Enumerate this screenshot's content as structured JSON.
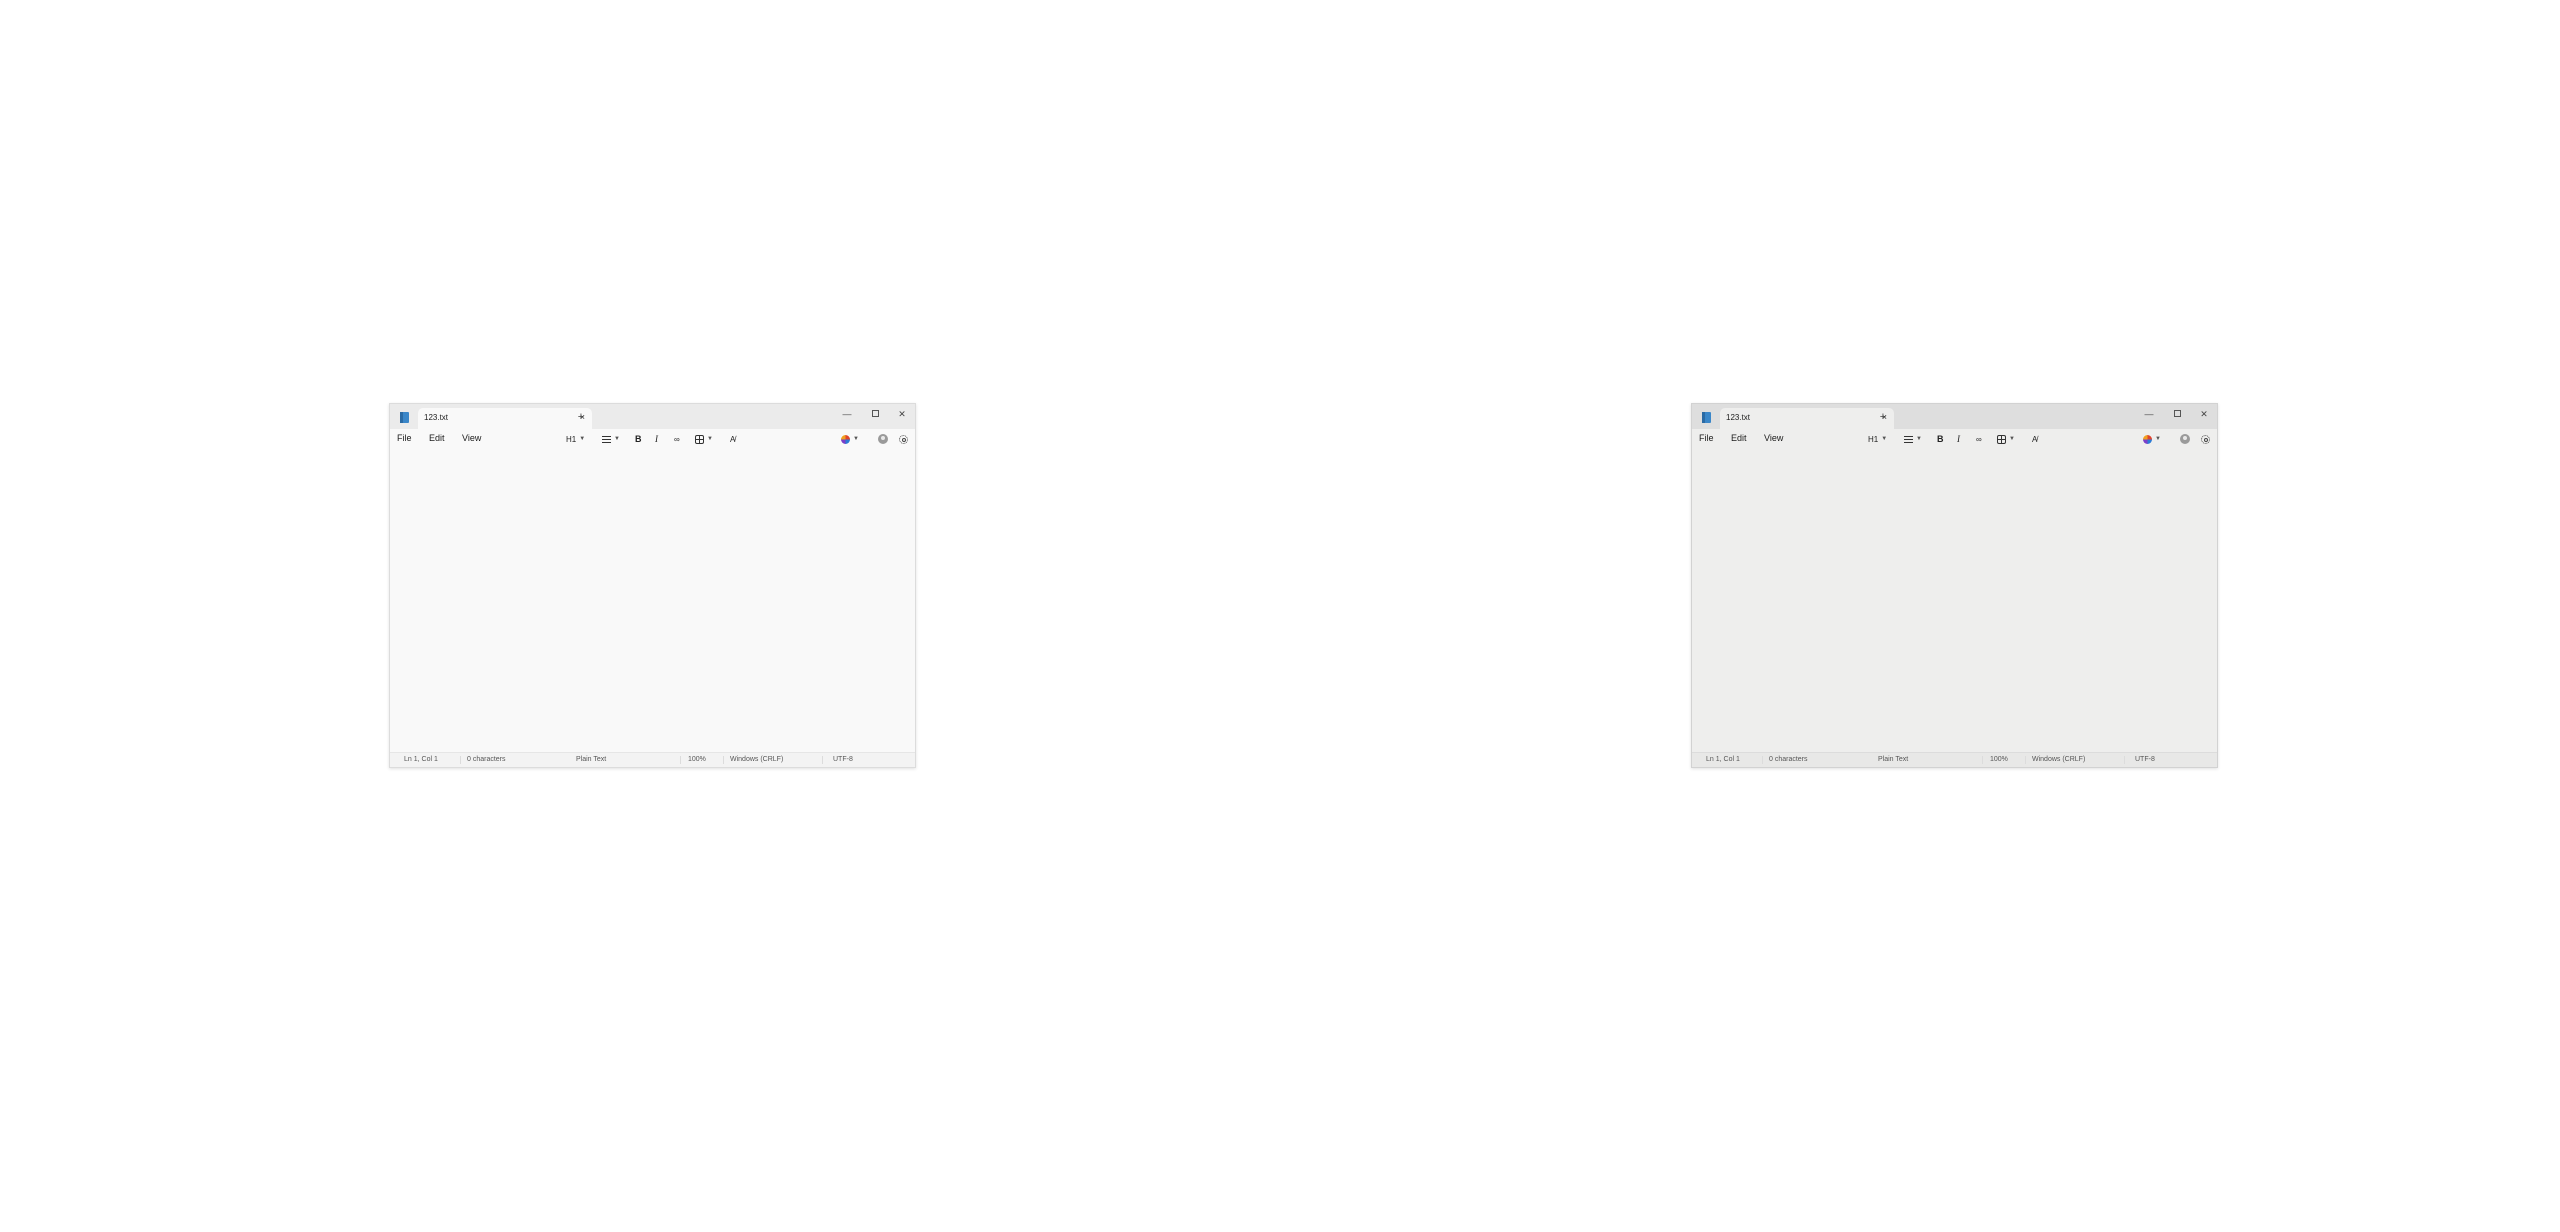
{
  "windows": [
    {
      "tab": {
        "title": "123.txt",
        "close_label": "×"
      },
      "new_tab_label": "+",
      "controls": {
        "minimize": "—",
        "close": "✕"
      },
      "menu": {
        "file": "File",
        "edit": "Edit",
        "view": "View"
      },
      "toolbar": {
        "heading": "H1"
      },
      "status": {
        "position": "Ln 1, Col 1",
        "characters": "0 characters",
        "format": "Plain Text",
        "zoom": "100%",
        "line_ending": "Windows (CRLF)",
        "encoding": "UTF-8"
      }
    },
    {
      "tab": {
        "title": "123.txt",
        "close_label": "×"
      },
      "new_tab_label": "+",
      "controls": {
        "minimize": "—",
        "close": "✕"
      },
      "menu": {
        "file": "File",
        "edit": "Edit",
        "view": "View"
      },
      "toolbar": {
        "heading": "H1"
      },
      "status": {
        "position": "Ln 1, Col 1",
        "characters": "0 characters",
        "format": "Plain Text",
        "zoom": "100%",
        "line_ending": "Windows (CRLF)",
        "encoding": "UTF-8"
      }
    }
  ],
  "icons": {
    "app": "notepad-icon",
    "list": "list-icon",
    "bold": "bold-icon",
    "italic": "italic-icon",
    "link": "link-icon",
    "table": "table-icon",
    "clear_format": "clear-formatting-icon",
    "copilot": "copilot-icon",
    "account": "account-icon",
    "settings": "gear-icon"
  },
  "colors": {
    "accent": "#3a86c8"
  }
}
